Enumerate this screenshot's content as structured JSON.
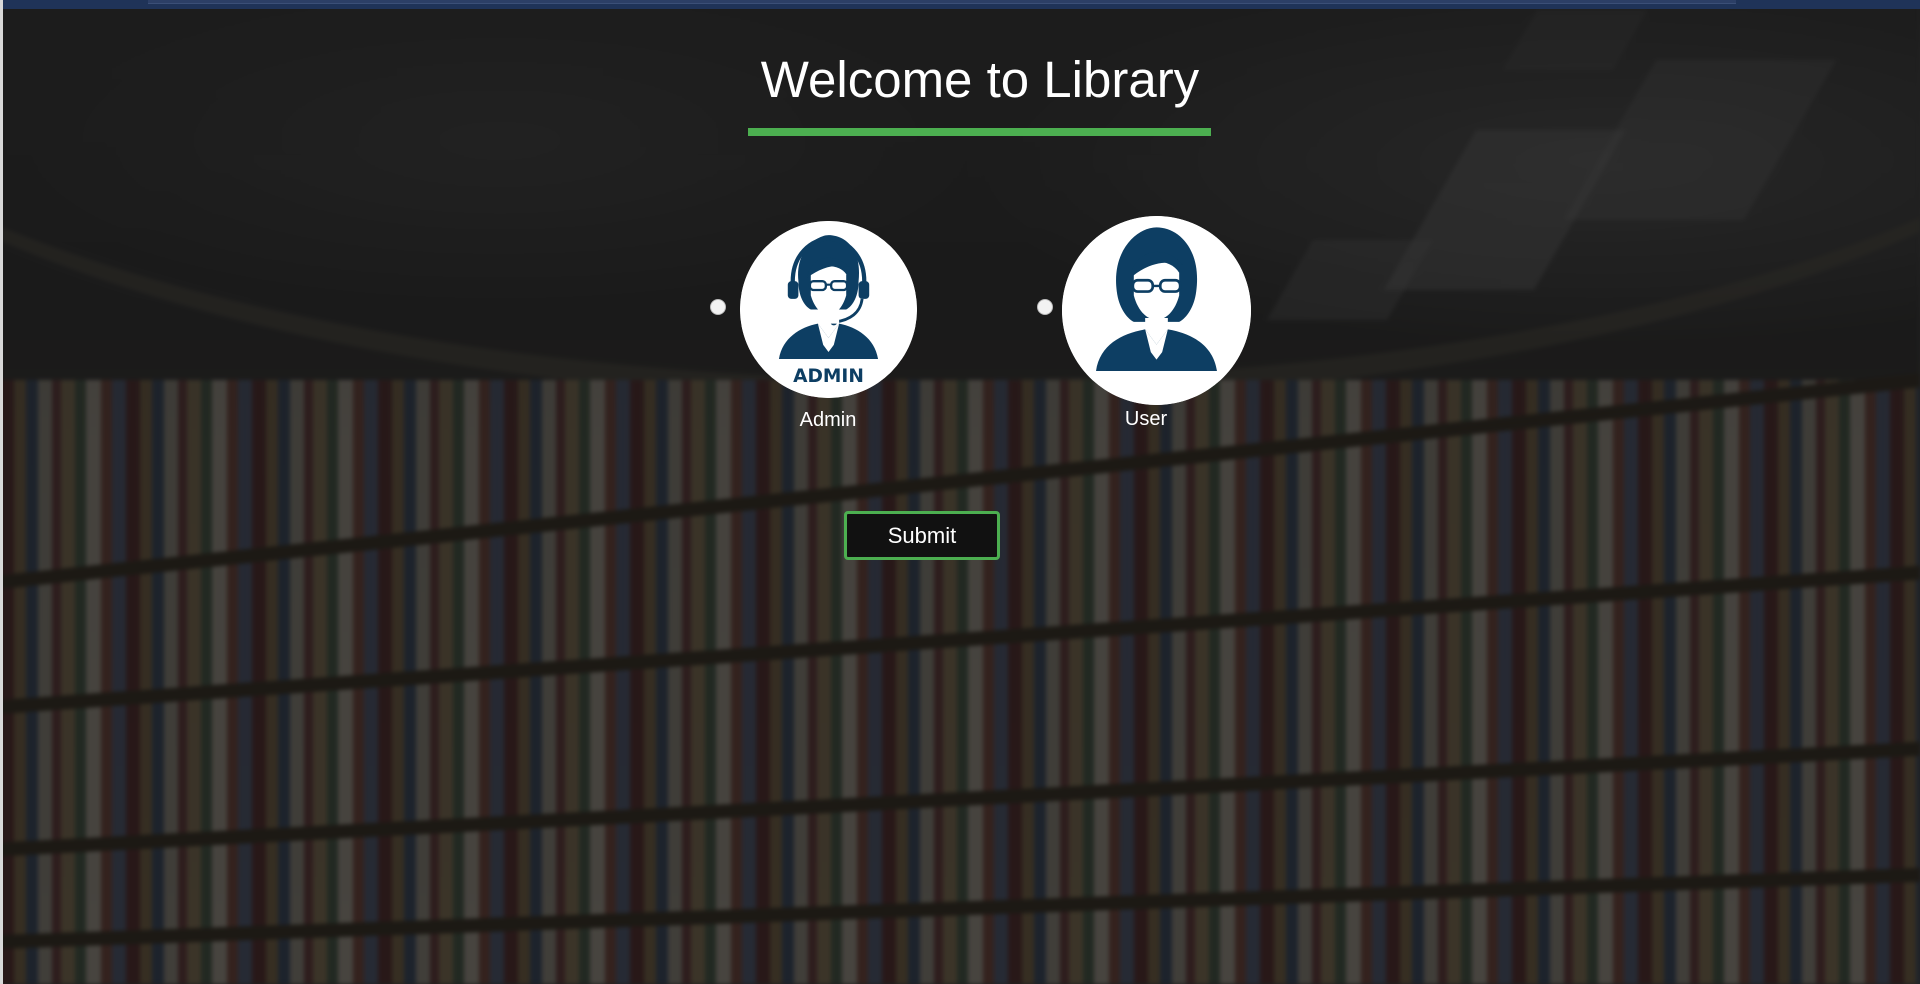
{
  "page": {
    "title": "Welcome to Library",
    "accent_color": "#4caf50",
    "background": "blurred-library-bookshelves-image"
  },
  "roles": [
    {
      "label": "Admin",
      "avatar_text": "ADMIN",
      "icon": "admin-avatar-icon",
      "selected": false
    },
    {
      "label": "User",
      "icon": "user-avatar-icon",
      "selected": false
    }
  ],
  "actions": {
    "submit_label": "Submit"
  },
  "colors": {
    "avatar_fill": "#0d3e63",
    "avatar_bg": "#ffffff",
    "button_border": "#4caf50"
  }
}
